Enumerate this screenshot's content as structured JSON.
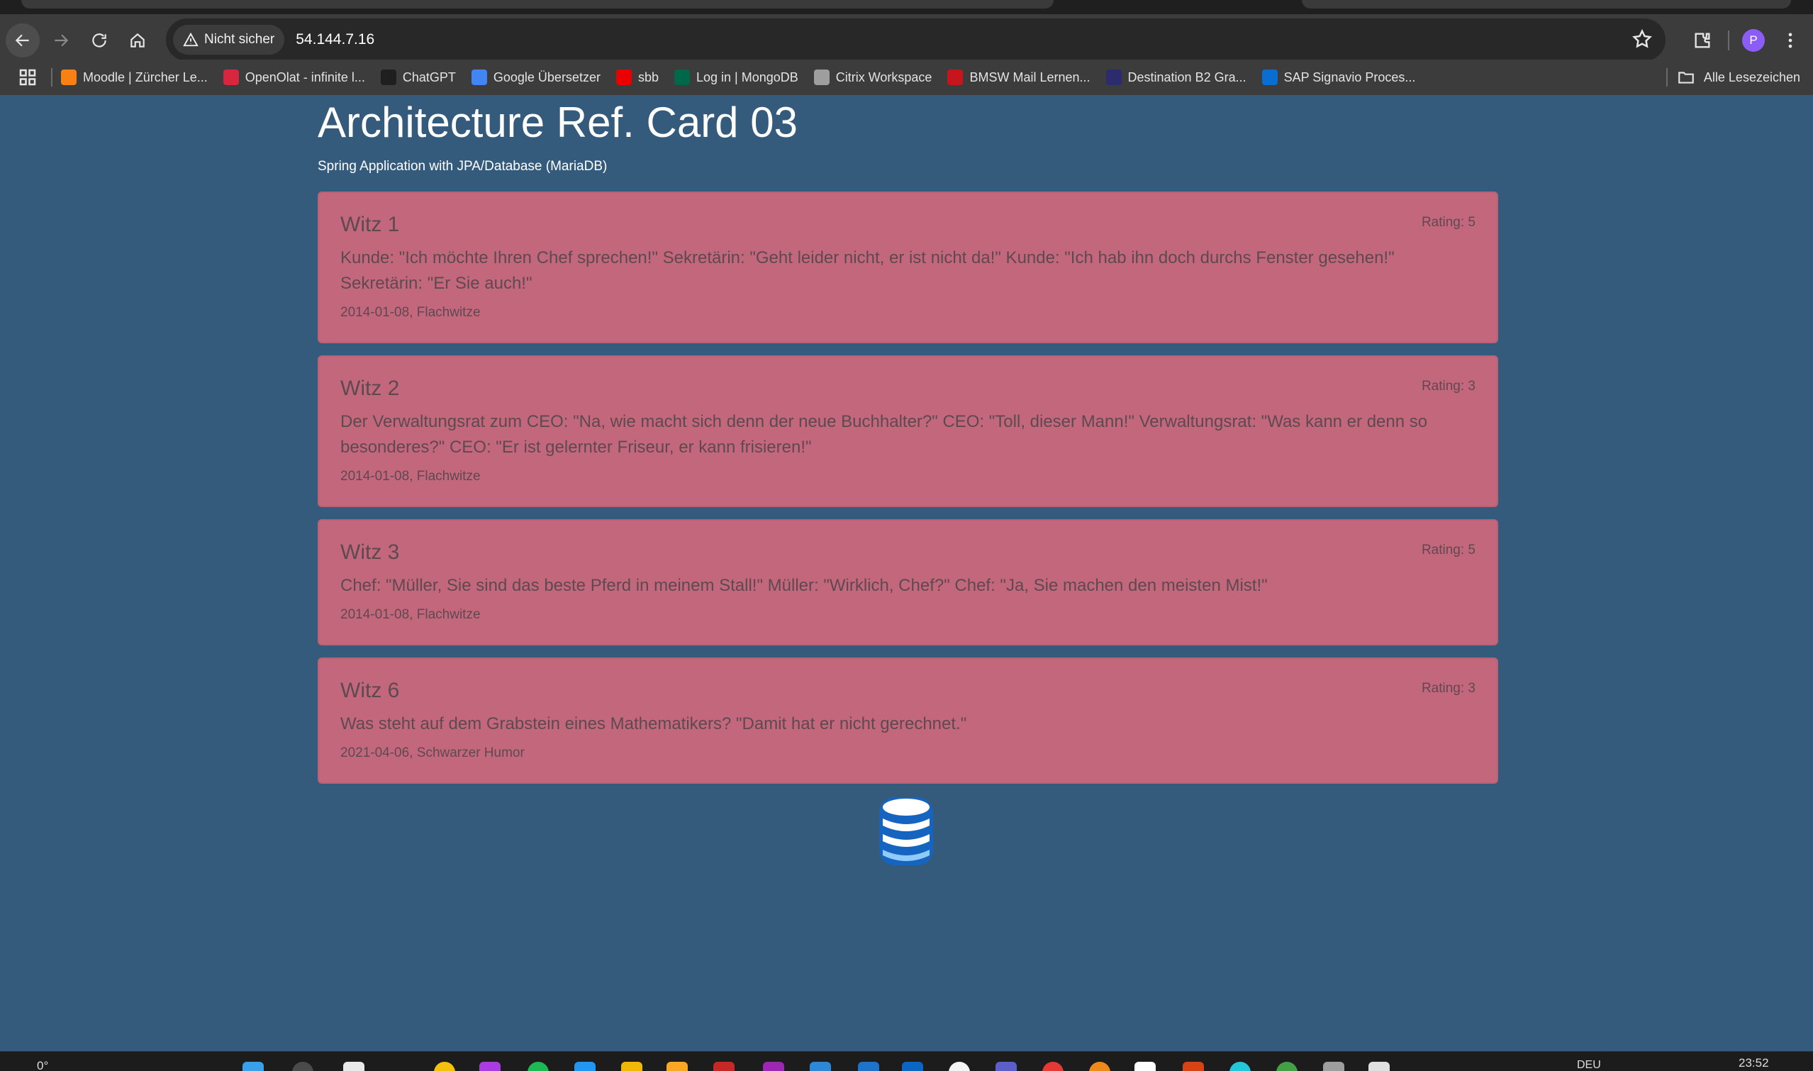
{
  "browser": {
    "security_label": "Nicht sicher",
    "url": "54.144.7.16",
    "profile_initial": "P"
  },
  "bookmarks": {
    "items": [
      {
        "label": "Moodle | Zürcher Le...",
        "color": "#f98012"
      },
      {
        "label": "OpenOlat - infinite l...",
        "color": "#d7263d"
      },
      {
        "label": "ChatGPT",
        "color": "#1f1f1f"
      },
      {
        "label": "Google Übersetzer",
        "color": "#4285f4"
      },
      {
        "label": "sbb",
        "color": "#eb0000"
      },
      {
        "label": "Log in | MongoDB",
        "color": "#00684a"
      },
      {
        "label": "Citrix Workspace",
        "color": "#9e9e9e"
      },
      {
        "label": "BMSW Mail Lernen...",
        "color": "#c4161c"
      },
      {
        "label": "Destination B2 Gra...",
        "color": "#2b2b6e"
      },
      {
        "label": "SAP Signavio Proces...",
        "color": "#0a6ed1"
      }
    ],
    "all_label": "Alle Lesezeichen"
  },
  "page": {
    "title": "Architecture Ref. Card 03",
    "subtitle": "Spring Application with JPA/Database (MariaDB)"
  },
  "jokes": [
    {
      "title": "Witz 1",
      "rating": "Rating: 5",
      "text": "Kunde: \"Ich möchte Ihren Chef sprechen!\" Sekretärin: \"Geht leider nicht, er ist nicht da!\" Kunde: \"Ich hab ihn doch durchs Fenster gesehen!\" Sekretärin: \"Er Sie auch!\"",
      "date": "2014-01-08",
      "category": "Flachwitze"
    },
    {
      "title": "Witz 2",
      "rating": "Rating: 3",
      "text": "Der Verwaltungsrat zum CEO: \"Na, wie macht sich denn der neue Buchhalter?\" CEO: \"Toll, dieser Mann!\" Verwaltungsrat: \"Was kann er denn so besonderes?\" CEO: \"Er ist gelernter Friseur, er kann frisieren!\"",
      "date": "2014-01-08",
      "category": "Flachwitze"
    },
    {
      "title": "Witz 3",
      "rating": "Rating: 5",
      "text": "Chef: \"Müller, Sie sind das beste Pferd in meinem Stall!\" Müller: \"Wirklich, Chef?\" Chef: \"Ja, Sie machen den meisten Mist!\"",
      "date": "2014-01-08",
      "category": "Flachwitze"
    },
    {
      "title": "Witz 6",
      "rating": "Rating: 3",
      "text": "Was steht auf dem Grabstein eines Mathematikers? \"Damit hat er nicht gerechnet.\"",
      "date": "2021-04-06",
      "category": "Schwarzer Humor"
    }
  ],
  "taskbar": {
    "weather": "0°",
    "language": "DEU",
    "time": "23:52"
  },
  "colors": {
    "page_background": "#355b7c",
    "card_background": "#c3687c",
    "database_icon": "#1976d2"
  }
}
